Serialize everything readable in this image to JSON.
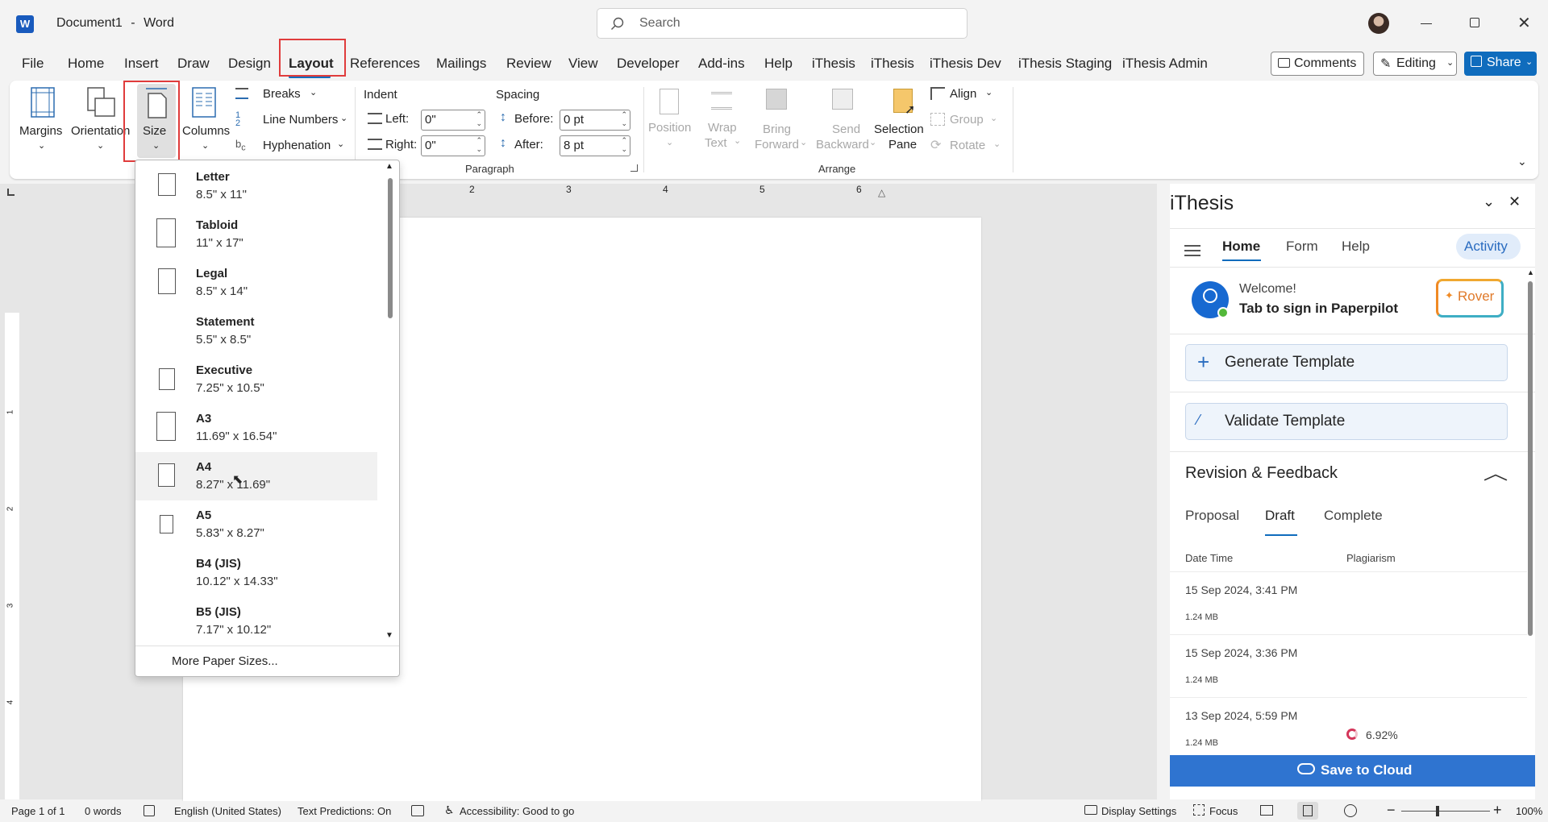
{
  "app": {
    "doc_title": "Document1",
    "separator": "-",
    "app_name": "Word"
  },
  "search": {
    "placeholder": "Search"
  },
  "menu": {
    "tabs": [
      "File",
      "Home",
      "Insert",
      "Draw",
      "Design",
      "Layout",
      "References",
      "Mailings",
      "Review",
      "View",
      "Developer",
      "Add-ins",
      "Help",
      "iThesis",
      "iThesis",
      "iThesis Dev",
      "iThesis Staging",
      "iThesis Admin"
    ],
    "active": "Layout",
    "comments_label": "Comments",
    "editing_label": "Editing",
    "share_label": "Share"
  },
  "ribbon": {
    "page_setup": {
      "margins": "Margins",
      "orientation": "Orientation",
      "size": "Size",
      "columns": "Columns",
      "breaks": "Breaks",
      "line_numbers": "Line Numbers",
      "hyphenation": "Hyphenation"
    },
    "paragraph": {
      "indent_title": "Indent",
      "spacing_title": "Spacing",
      "left_label": "Left:",
      "left_value": "0\"",
      "right_label": "Right:",
      "right_value": "0\"",
      "before_label": "Before:",
      "before_value": "0 pt",
      "after_label": "After:",
      "after_value": "8 pt",
      "group_label": "Paragraph"
    },
    "arrange": {
      "position": "Position",
      "wrap1": "Wrap",
      "wrap2": "Text",
      "bring1": "Bring",
      "bring2": "Forward",
      "send1": "Send",
      "send2": "Backward",
      "sel1": "Selection",
      "sel2": "Pane",
      "align": "Align",
      "group": "Group",
      "rotate": "Rotate",
      "group_label": "Arrange"
    }
  },
  "ruler": {
    "marks": [
      "2",
      "3",
      "4",
      "5",
      "6"
    ],
    "vmarks": [
      "1",
      "2",
      "3",
      "4"
    ]
  },
  "size_menu": {
    "items": [
      {
        "name": "Letter",
        "size": "8.5\" x 11\""
      },
      {
        "name": "Tabloid",
        "size": "11\" x 17\""
      },
      {
        "name": "Legal",
        "size": "8.5\" x 14\""
      },
      {
        "name": "Statement",
        "size": "5.5\" x 8.5\""
      },
      {
        "name": "Executive",
        "size": "7.25\" x 10.5\""
      },
      {
        "name": "A3",
        "size": "11.69\" x 16.54\""
      },
      {
        "name": "A4",
        "size": "8.27\" x 11.69\""
      },
      {
        "name": "A5",
        "size": "5.83\" x 8.27\""
      },
      {
        "name": "B4 (JIS)",
        "size": "10.12\" x 14.33\""
      },
      {
        "name": "B5 (JIS)",
        "size": "7.17\" x 10.12\""
      }
    ],
    "selected": "A4",
    "more": "More Paper Sizes..."
  },
  "pane": {
    "title": "iThesis",
    "tabs": [
      "Home",
      "Form",
      "Help"
    ],
    "activity": "Activity",
    "welcome": "Welcome!",
    "signin": "Tab to sign in Paperpilot",
    "rover": "Rover",
    "generate": "Generate Template",
    "validate": "Validate Template",
    "revision_title": "Revision & Feedback",
    "rev_tabs": [
      "Proposal",
      "Draft",
      "Complete"
    ],
    "rev_active": "Draft",
    "col_date": "Date Time",
    "col_plag": "Plagiarism",
    "rows": [
      {
        "date": "15 Sep 2024, 3:41 PM",
        "size": "1.24 MB",
        "plag": ""
      },
      {
        "date": "15 Sep 2024, 3:36 PM",
        "size": "1.24 MB",
        "plag": ""
      },
      {
        "date": "13 Sep 2024, 5:59 PM",
        "size": "1.24 MB",
        "plag": "6.92%"
      }
    ],
    "save": "Save to Cloud"
  },
  "status": {
    "page": "Page 1 of 1",
    "words": "0 words",
    "lang": "English (United States)",
    "predictions": "Text Predictions: On",
    "accessibility": "Accessibility: Good to go",
    "display": "Display Settings",
    "focus": "Focus",
    "zoom": "100%"
  },
  "colors": {
    "accent": "#0f6cbd",
    "highlight_red": "#e03c3c",
    "save_bar": "#2f74d0"
  }
}
